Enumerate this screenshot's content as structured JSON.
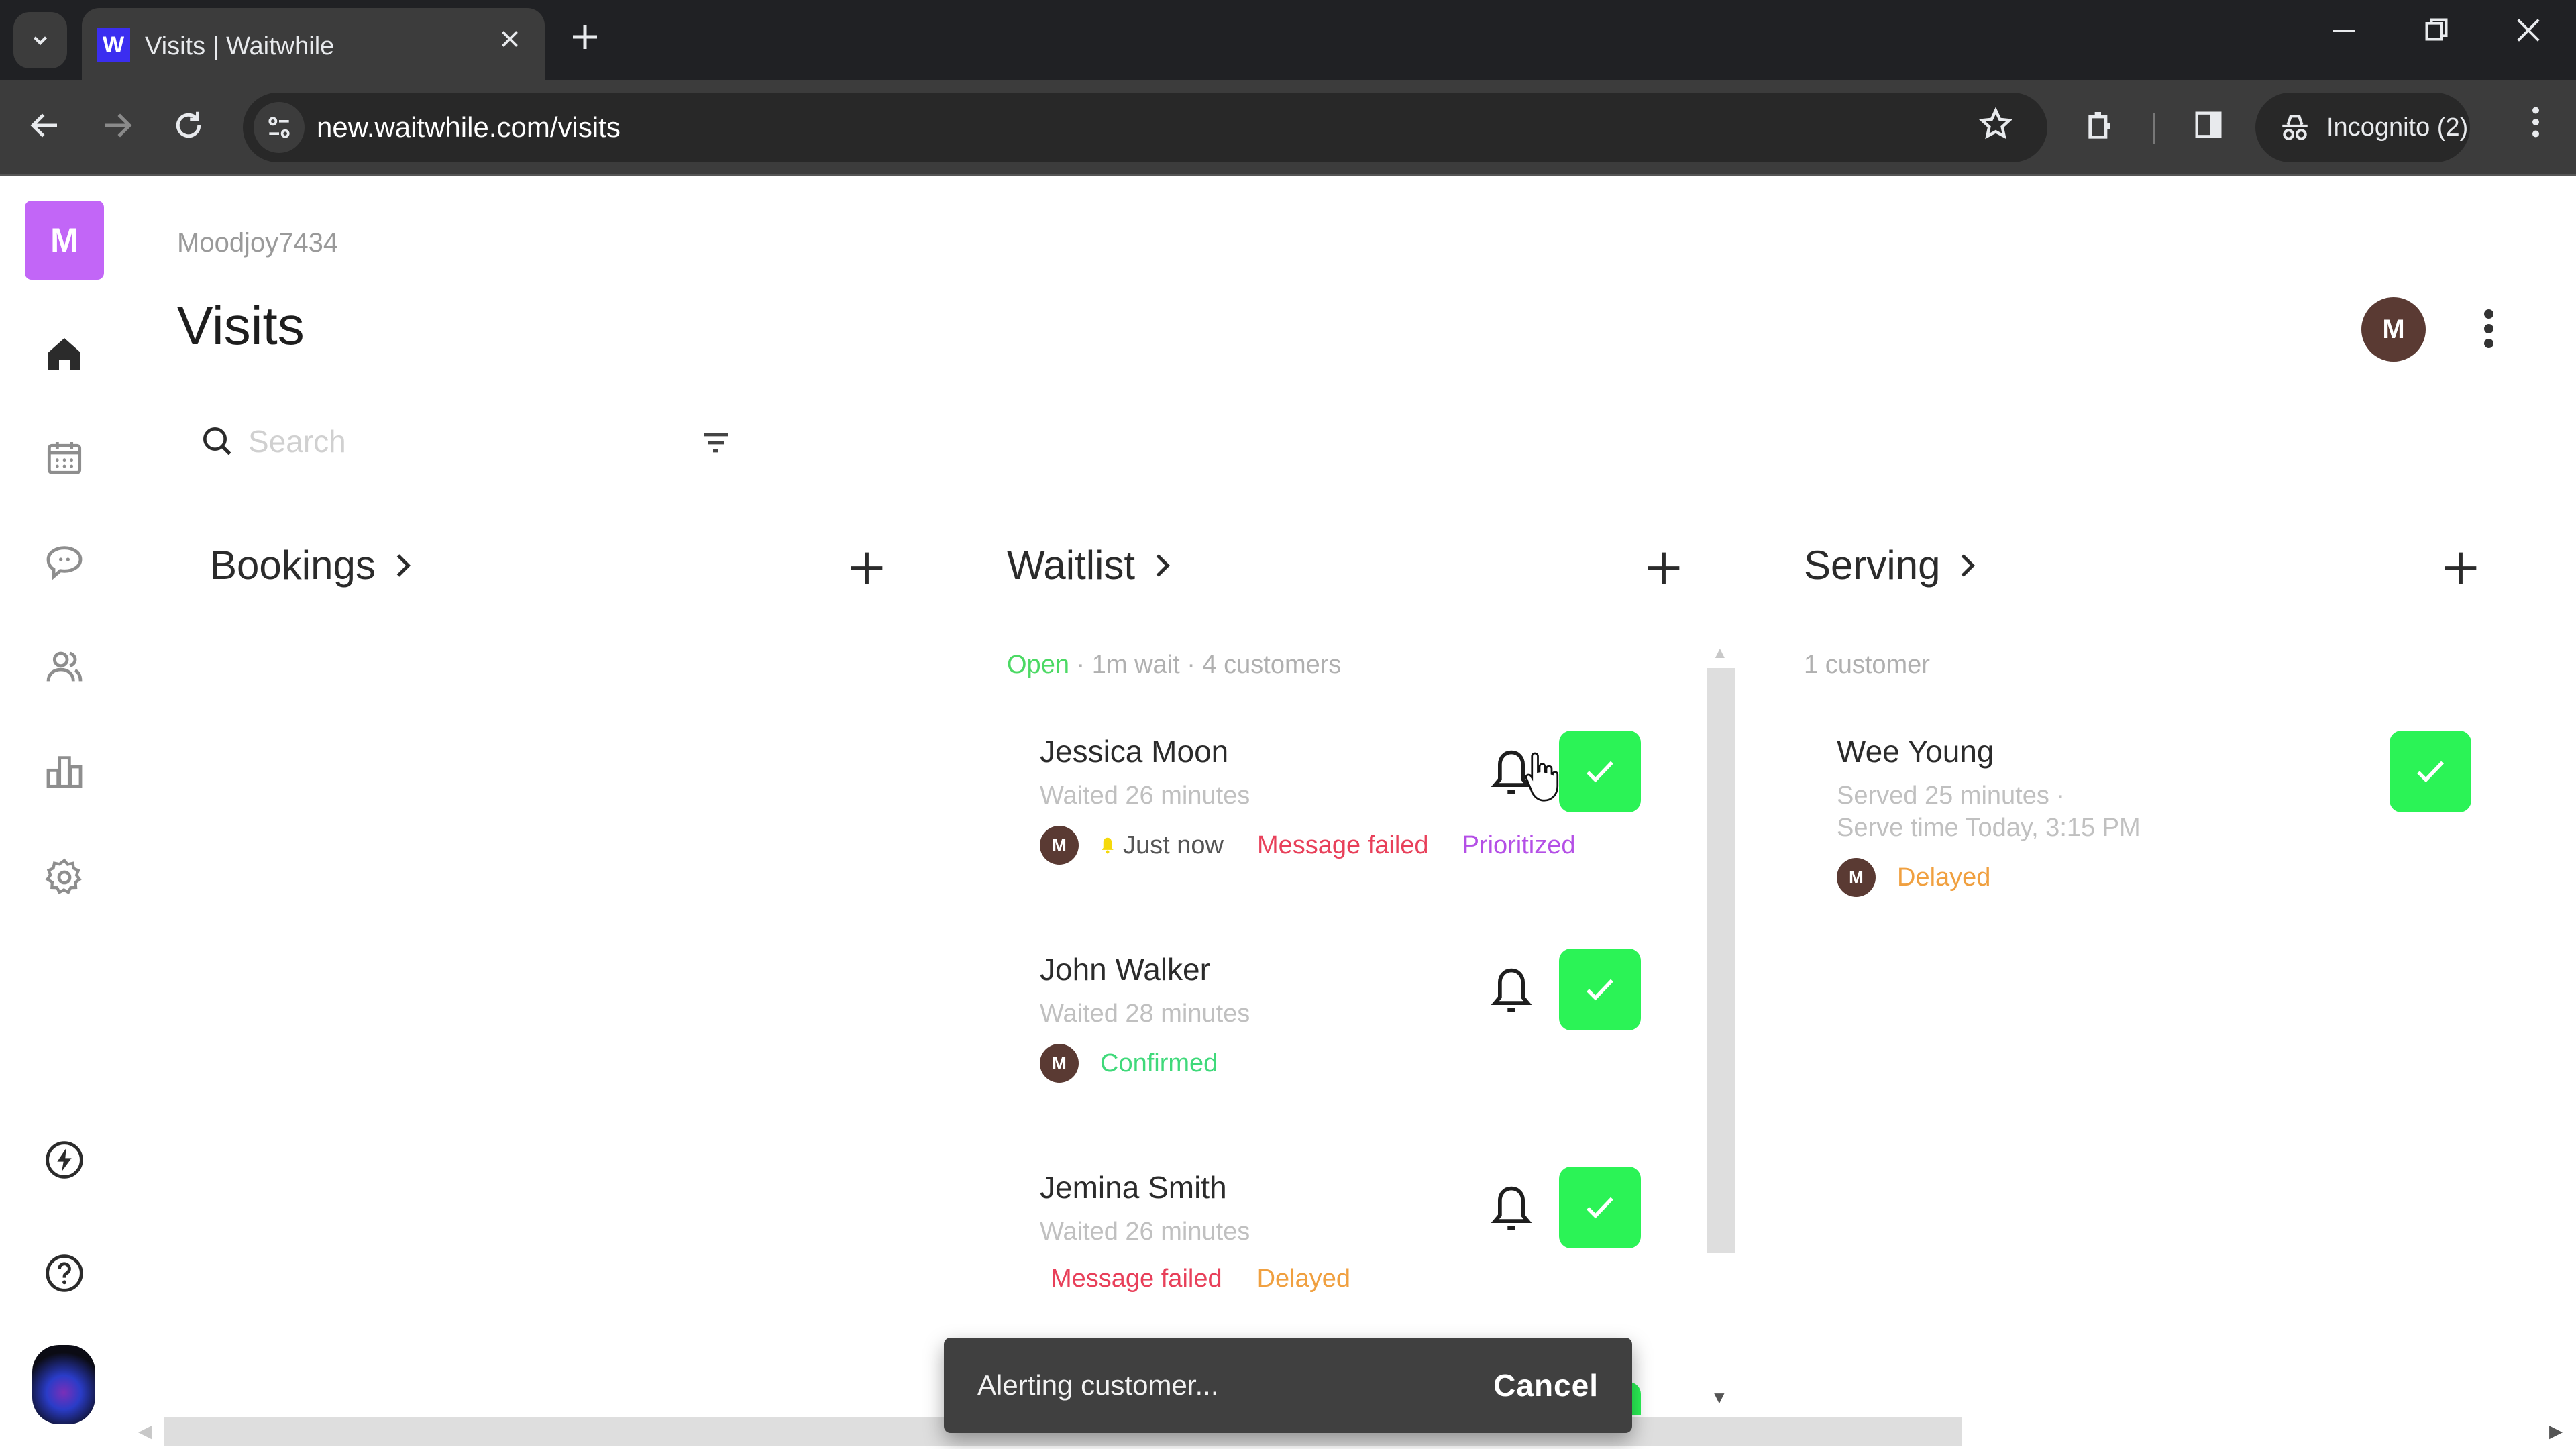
{
  "browser": {
    "tab_title": "Visits | Waitwhile",
    "favicon_letter": "W",
    "url": "new.waitwhile.com/visits",
    "incognito_label": "Incognito (2)"
  },
  "sidebar": {
    "brand_letter": "M",
    "items": [
      {
        "name": "home",
        "active": true
      },
      {
        "name": "calendar"
      },
      {
        "name": "messages"
      },
      {
        "name": "customers"
      },
      {
        "name": "analytics"
      },
      {
        "name": "settings"
      }
    ],
    "bottom_items": [
      {
        "name": "quick-actions"
      },
      {
        "name": "help"
      }
    ]
  },
  "header": {
    "account_name": "Moodjoy7434",
    "title": "Visits",
    "avatar_letter": "M"
  },
  "search": {
    "placeholder": "Search",
    "value": ""
  },
  "columns": {
    "bookings": {
      "title": "Bookings",
      "add_label": "+"
    },
    "waitlist": {
      "title": "Waitlist",
      "status": "Open",
      "meta": " · 1m wait · 4 customers",
      "items": [
        {
          "name": "Jessica Moon",
          "sub": "Waited 26 minutes",
          "avatar": "M",
          "notified": "Just now",
          "tags": [
            {
              "label": "Message failed",
              "color": "#e8405a"
            },
            {
              "label": "Prioritized",
              "color": "#b44fe6"
            }
          ]
        },
        {
          "name": "John Walker",
          "sub": "Waited 28 minutes",
          "avatar": "M",
          "tags": [
            {
              "label": "Confirmed",
              "color": "#3fd97a"
            }
          ]
        },
        {
          "name": "Jemina Smith",
          "sub": "Waited 26 minutes",
          "tags": [
            {
              "label": "Message failed",
              "color": "#e8405a"
            },
            {
              "label": "Delayed",
              "color": "#f0a040"
            }
          ]
        }
      ]
    },
    "serving": {
      "title": "Serving",
      "meta": "1 customer",
      "items": [
        {
          "name": "Wee Young",
          "sub": "Served 25 minutes ·",
          "sub2": "Serve time Today, 3:15 PM",
          "avatar": "M",
          "tags": [
            {
              "label": "Delayed",
              "color": "#f0a040"
            }
          ]
        }
      ]
    }
  },
  "toast": {
    "message": "Alerting customer...",
    "action": "Cancel"
  },
  "colors": {
    "brand": "#c266f7",
    "check_green": "#2bf356",
    "avatar_brown": "#5a3a33",
    "open_green": "#4cd964"
  }
}
